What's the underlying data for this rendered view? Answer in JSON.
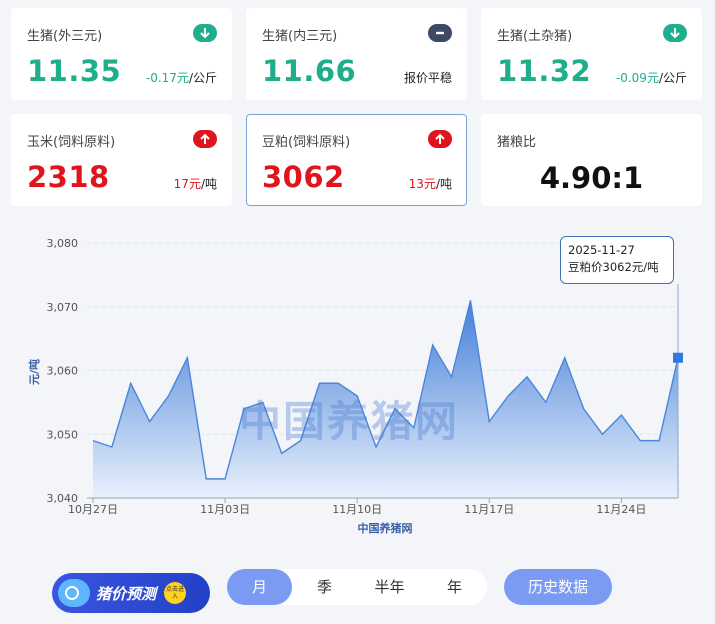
{
  "cards": [
    {
      "label": "生猪(外三元)",
      "price": "11.35",
      "change_value": "-0.17元",
      "change_unit": "/公斤",
      "trend": "down",
      "icon": "arrow-down-icon"
    },
    {
      "label": "生猪(内三元)",
      "price": "11.66",
      "change_value": "",
      "change_unit": "报价平稳",
      "trend": "flat",
      "icon": "minus-icon"
    },
    {
      "label": "生猪(土杂猪)",
      "price": "11.32",
      "change_value": "-0.09元",
      "change_unit": "/公斤",
      "trend": "down",
      "icon": "arrow-down-icon"
    },
    {
      "label": "玉米(饲料原料)",
      "price": "2318",
      "change_value": "17元",
      "change_unit": "/吨",
      "trend": "up",
      "icon": "arrow-up-icon"
    },
    {
      "label": "豆粕(饲料原料)",
      "price": "3062",
      "change_value": "13元",
      "change_unit": "/吨",
      "trend": "up",
      "icon": "arrow-up-icon"
    },
    {
      "label": "猪粮比",
      "price": "4.90:1",
      "trend": "none"
    }
  ],
  "chart_data": {
    "type": "area",
    "ylabel": "元/吨",
    "xlabel": "中国养猪网",
    "ylim": [
      3040,
      3080
    ],
    "yticks": [
      "3,040",
      "3,050",
      "3,060",
      "3,070",
      "3,080"
    ],
    "xticks": [
      "10月27日",
      "11月03日",
      "11月10日",
      "11月17日",
      "11月24日"
    ],
    "series": [
      {
        "values": [
          3049,
          3048,
          3058,
          3052,
          3056,
          3062,
          3043,
          3043,
          3054,
          3055,
          3047,
          3049,
          3058,
          3058,
          3056,
          3048,
          3054,
          3051,
          3064,
          3059,
          3071,
          3052,
          3056,
          3059,
          3055,
          3062,
          3054,
          3050,
          3053,
          3049,
          3049,
          3062
        ]
      }
    ],
    "grid": true,
    "color": "#4a86db"
  },
  "tooltip": {
    "date": "2025-11-27",
    "text": "豆粕价3062元/吨"
  },
  "watermark": "中国养猪网",
  "promo": {
    "text": "猪价预测",
    "badge": "点击进入"
  },
  "tabs": [
    "月",
    "季",
    "半年",
    "年"
  ],
  "history_label": "历史数据"
}
